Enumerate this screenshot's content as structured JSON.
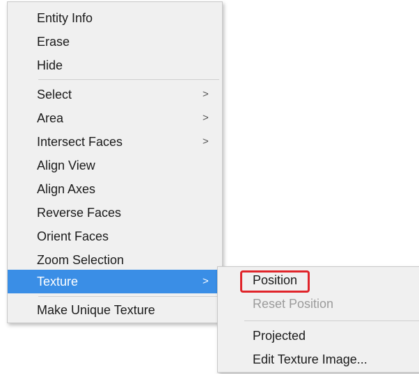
{
  "context_menu": {
    "items": [
      {
        "label": "Entity Info"
      },
      {
        "label": "Erase"
      },
      {
        "label": "Hide"
      },
      {
        "label": "Select",
        "arrow": ">"
      },
      {
        "label": "Area",
        "arrow": ">"
      },
      {
        "label": "Intersect Faces",
        "arrow": ">"
      },
      {
        "label": "Align View"
      },
      {
        "label": "Align Axes"
      },
      {
        "label": "Reverse Faces"
      },
      {
        "label": "Orient Faces"
      },
      {
        "label": "Zoom Selection"
      },
      {
        "label": "Texture",
        "arrow": ">",
        "selected": true
      },
      {
        "label": "Make Unique Texture"
      }
    ]
  },
  "texture_submenu": {
    "items": [
      {
        "label": "Position",
        "highlighted": true
      },
      {
        "label": "Reset Position",
        "disabled": true
      },
      {
        "label": "Projected"
      },
      {
        "label": "Edit Texture Image..."
      }
    ]
  },
  "colors": {
    "selection": "#3a8ee6",
    "highlight_box": "#e0242a",
    "menu_background": "#f0f0f0",
    "disabled_text": "#9b9b9b"
  }
}
